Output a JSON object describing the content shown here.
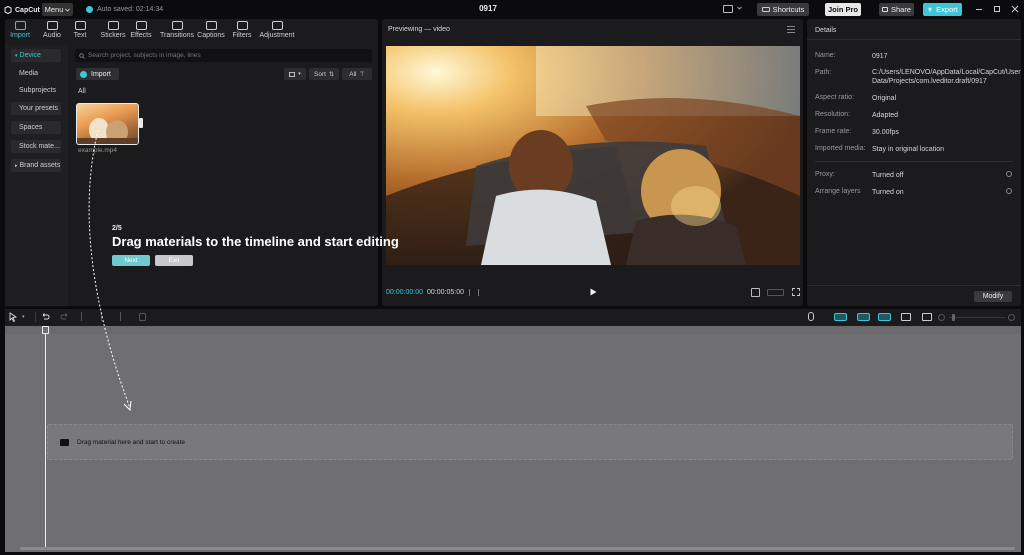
{
  "titlebar": {
    "logo_text": "CapCut",
    "menu_label": "Menu",
    "autosave_text": "Auto saved: 02:14:34",
    "project_title": "0917",
    "shortcuts_label": "Shortcuts",
    "join_pro_label": "Join Pro",
    "share_label": "Share",
    "export_label": "Export",
    "accent_color": "#41c4d6"
  },
  "media": {
    "tabs": [
      {
        "label": "Import",
        "icon": "import-icon"
      },
      {
        "label": "Audio",
        "icon": "audio-icon"
      },
      {
        "label": "Text",
        "icon": "text-icon"
      },
      {
        "label": "Stickers",
        "icon": "sticker-icon"
      },
      {
        "label": "Effects",
        "icon": "effects-icon"
      },
      {
        "label": "Transitions",
        "icon": "transitions-icon"
      },
      {
        "label": "Captions",
        "icon": "captions-icon"
      },
      {
        "label": "Filters",
        "icon": "filters-icon"
      },
      {
        "label": "Adjustment",
        "icon": "adjustment-icon"
      }
    ],
    "sidebar": [
      {
        "label": "Device"
      },
      {
        "label": "Media"
      },
      {
        "label": "Subprojects"
      },
      {
        "label": "Your presets"
      },
      {
        "label": "Spaces"
      },
      {
        "label": "Stock mate..."
      },
      {
        "label": "Brand assets"
      }
    ],
    "search_placeholder": "Search project, subjects in image, lines",
    "import_label": "Import",
    "sort_label": "Sort",
    "all_filter_label": "All",
    "section_label": "All",
    "file_name": "example.mp4"
  },
  "tour": {
    "step": "2/5",
    "title": "Drag materials to the timeline and start editing",
    "next_label": "Next",
    "exit_label": "Exit"
  },
  "player": {
    "header": "Previewing — video",
    "current_time": "00:00:00:00",
    "total_time": "00:00:05:00"
  },
  "details": {
    "header": "Details",
    "rows": [
      {
        "label": "Name:",
        "value": "0917"
      },
      {
        "label": "Path:",
        "value": "C:/Users/LENOVO/AppData/Local/CapCut/User Data/Projects/com.lveditor.draft/0917"
      },
      {
        "label": "Aspect ratio:",
        "value": "Original"
      },
      {
        "label": "Resolution:",
        "value": "Adapted"
      },
      {
        "label": "Frame rate:",
        "value": "30.00fps"
      },
      {
        "label": "Imported media:",
        "value": "Stay in original location"
      },
      {
        "label": "Proxy:",
        "value": "Turned off"
      },
      {
        "label": "Arrange layers",
        "value": "Turned on"
      }
    ],
    "modify_label": "Modify"
  },
  "timeline": {
    "drop_hint": "Drag material here and start to create"
  }
}
